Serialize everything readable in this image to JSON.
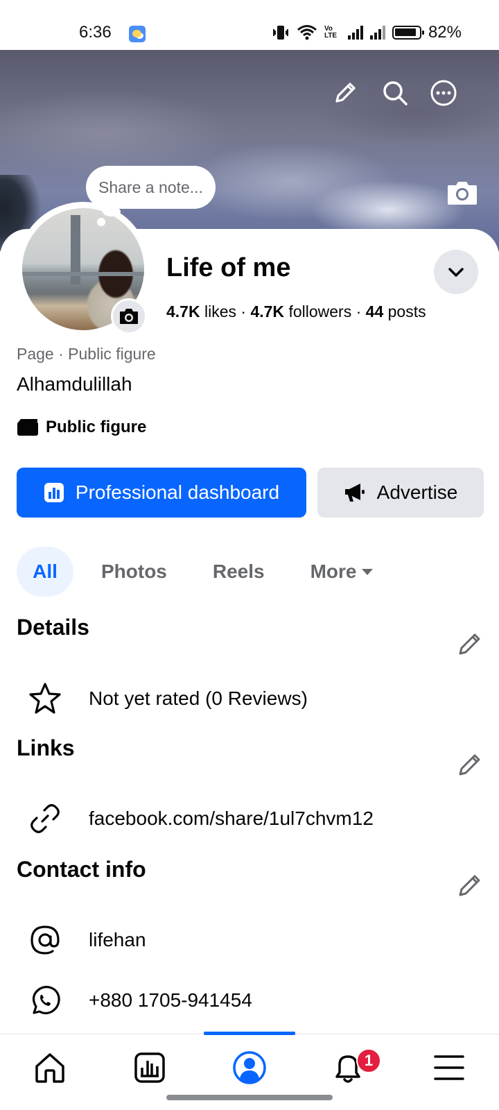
{
  "status_bar": {
    "time": "6:36",
    "battery": "82%",
    "volte": "Vo LTE"
  },
  "cover": {
    "note_placeholder": "Share a note..."
  },
  "profile": {
    "name": "Life of me",
    "likes_count": "4.7K",
    "likes_label": "likes",
    "followers_count": "4.7K",
    "followers_label": "followers",
    "posts_count": "44",
    "posts_label": "posts",
    "separator": "·",
    "category": "Page · Public figure",
    "bio": "Alhamdulillah",
    "badge": "Public figure"
  },
  "actions": {
    "primary": "Professional dashboard",
    "secondary": "Advertise"
  },
  "tabs": [
    {
      "label": "All",
      "active": true
    },
    {
      "label": "Photos",
      "active": false
    },
    {
      "label": "Reels",
      "active": false
    },
    {
      "label": "More",
      "active": false
    }
  ],
  "sections": {
    "details": {
      "title": "Details",
      "rating": "Not yet rated (0 Reviews)"
    },
    "links": {
      "title": "Links",
      "url": "facebook.com/share/1ul7chvm12"
    },
    "contact": {
      "title": "Contact info",
      "username": "lifehan",
      "phone": "+880 1705-941454"
    }
  },
  "bottom_nav": {
    "items": [
      "home-icon",
      "dashboard-icon",
      "profile-icon",
      "notifications-icon",
      "menu-icon"
    ],
    "notification_count": "1"
  },
  "colors": {
    "brand": "#0866ff",
    "badge": "#e41e3f",
    "muted": "#65676b",
    "surface": "#e4e6eb"
  }
}
